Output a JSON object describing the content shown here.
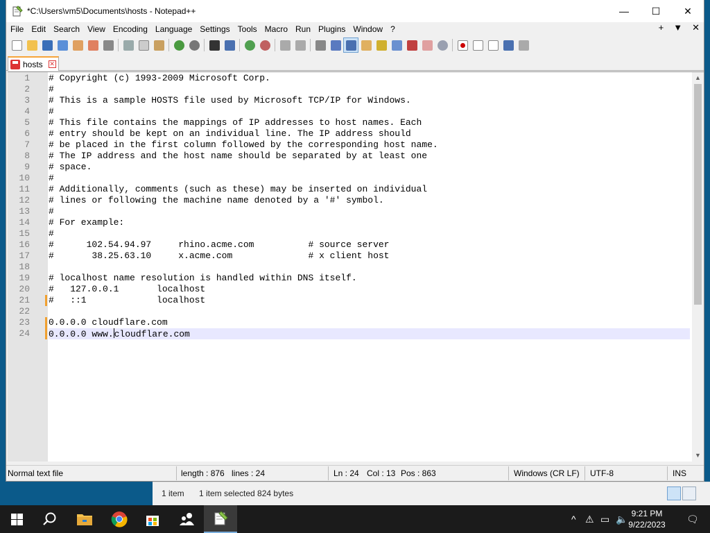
{
  "window": {
    "title": "*C:\\Users\\vm5\\Documents\\hosts - Notepad++",
    "minimize": "—",
    "maximize": "☐",
    "close": "✕"
  },
  "menu": {
    "items": [
      "File",
      "Edit",
      "Search",
      "View",
      "Encoding",
      "Language",
      "Settings",
      "Tools",
      "Macro",
      "Run",
      "Plugins",
      "Window",
      "?"
    ],
    "right": [
      "+",
      "▼",
      "✕"
    ]
  },
  "tab": {
    "label": "hosts",
    "close": "✕"
  },
  "editor": {
    "lines": [
      "# Copyright (c) 1993-2009 Microsoft Corp.",
      "#",
      "# This is a sample HOSTS file used by Microsoft TCP/IP for Windows.",
      "#",
      "# This file contains the mappings of IP addresses to host names. Each",
      "# entry should be kept on an individual line. The IP address should",
      "# be placed in the first column followed by the corresponding host name.",
      "# The IP address and the host name should be separated by at least one",
      "# space.",
      "#",
      "# Additionally, comments (such as these) may be inserted on individual",
      "# lines or following the machine name denoted by a '#' symbol.",
      "#",
      "# For example:",
      "#",
      "#      102.54.94.97     rhino.acme.com          # source server",
      "#       38.25.63.10     x.acme.com              # x client host",
      "",
      "# localhost name resolution is handled within DNS itself.",
      "#\t127.0.0.1       localhost",
      "#\t::1             localhost",
      "",
      "0.0.0.0 cloudflare.com",
      "0.0.0.0 www.cloudflare.com"
    ],
    "current_line_before_caret": "0.0.0.0 www.",
    "current_line_after_caret": "cloudflare.com"
  },
  "status": {
    "file_type": "Normal text file",
    "length": "length : 876",
    "lines": "lines : 24",
    "ln": "Ln : 24",
    "col": "Col : 13",
    "pos": "Pos : 863",
    "eol": "Windows (CR LF)",
    "encoding": "UTF-8",
    "mode": "INS"
  },
  "explorer": {
    "items": "1 item",
    "selected": "1 item selected  824 bytes"
  },
  "taskbar": {
    "time": "9:21 PM",
    "date": "9/22/2023"
  },
  "colors": {
    "tab_accent": "#f7a43a",
    "change_marker": "#f0a030",
    "current_line": "#e8e8ff",
    "taskbar": "#1b1b1b"
  }
}
